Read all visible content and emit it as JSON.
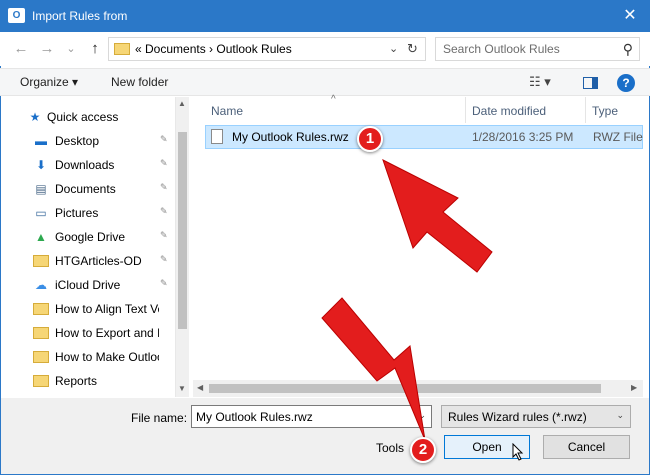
{
  "window": {
    "title": "Import Rules from",
    "app_icon": "O",
    "close_glyph": "✕"
  },
  "nav": {
    "back_glyph": "←",
    "forward_glyph": "→",
    "recent_glyph": "⌄",
    "up_glyph": "↑",
    "address_crumbs": "«  Documents  ›  Outlook Rules",
    "address_chevron": "⌄",
    "refresh_glyph": "↻",
    "search_placeholder": "Search Outlook Rules",
    "search_glyph": "⚲"
  },
  "toolbar": {
    "organize": "Organize ▾",
    "new_folder": "New folder",
    "view_glyph": "☷ ▾",
    "help": "?"
  },
  "sidebar": {
    "items": [
      {
        "label": "Quick access",
        "icon": "star-icon",
        "glyph": "★",
        "pinned": false
      },
      {
        "label": "Desktop",
        "icon": "desktop-icon",
        "glyph": "▬",
        "pinned": true
      },
      {
        "label": "Downloads",
        "icon": "download-icon",
        "glyph": "⬇",
        "pinned": true
      },
      {
        "label": "Documents",
        "icon": "documents-icon",
        "glyph": "▤",
        "pinned": true
      },
      {
        "label": "Pictures",
        "icon": "pictures-icon",
        "glyph": "▭",
        "pinned": true
      },
      {
        "label": "Google Drive",
        "icon": "google-drive-icon",
        "glyph": "▲",
        "pinned": true
      },
      {
        "label": "HTGArticles-OD",
        "icon": "folder-icon",
        "glyph": "",
        "pinned": true
      },
      {
        "label": "iCloud Drive",
        "icon": "cloud-icon",
        "glyph": "☁",
        "pinned": true
      },
      {
        "label": "How to Align Text Vert",
        "icon": "folder-icon",
        "glyph": "",
        "pinned": false
      },
      {
        "label": "How to Export and Imp",
        "icon": "folder-icon",
        "glyph": "",
        "pinned": false
      },
      {
        "label": "How to Make Outlook",
        "icon": "folder-icon",
        "glyph": "",
        "pinned": false
      },
      {
        "label": "Reports",
        "icon": "folder-icon",
        "glyph": "",
        "pinned": false
      }
    ],
    "pin_glyph": "📌"
  },
  "filelist": {
    "columns": [
      "Name",
      "Date modified",
      "Type"
    ],
    "sort_glyph": "^",
    "files": [
      {
        "name": "My Outlook Rules.rwz",
        "date": "1/28/2016 3:25 PM",
        "type": "RWZ File"
      }
    ]
  },
  "footer": {
    "file_name_label": "File name:",
    "file_name_value": "My Outlook Rules.rwz",
    "filter_value": "Rules Wizard rules (*.rwz)",
    "dropdown_glyph": "⌄",
    "tools_label": "Tools",
    "open_label": "Open",
    "cancel_label": "Cancel"
  },
  "callouts": [
    "1",
    "2"
  ],
  "colors": {
    "titlebar": "#2b78c8",
    "selection": "#cce8ff",
    "callout_red": "#e31d1d"
  }
}
